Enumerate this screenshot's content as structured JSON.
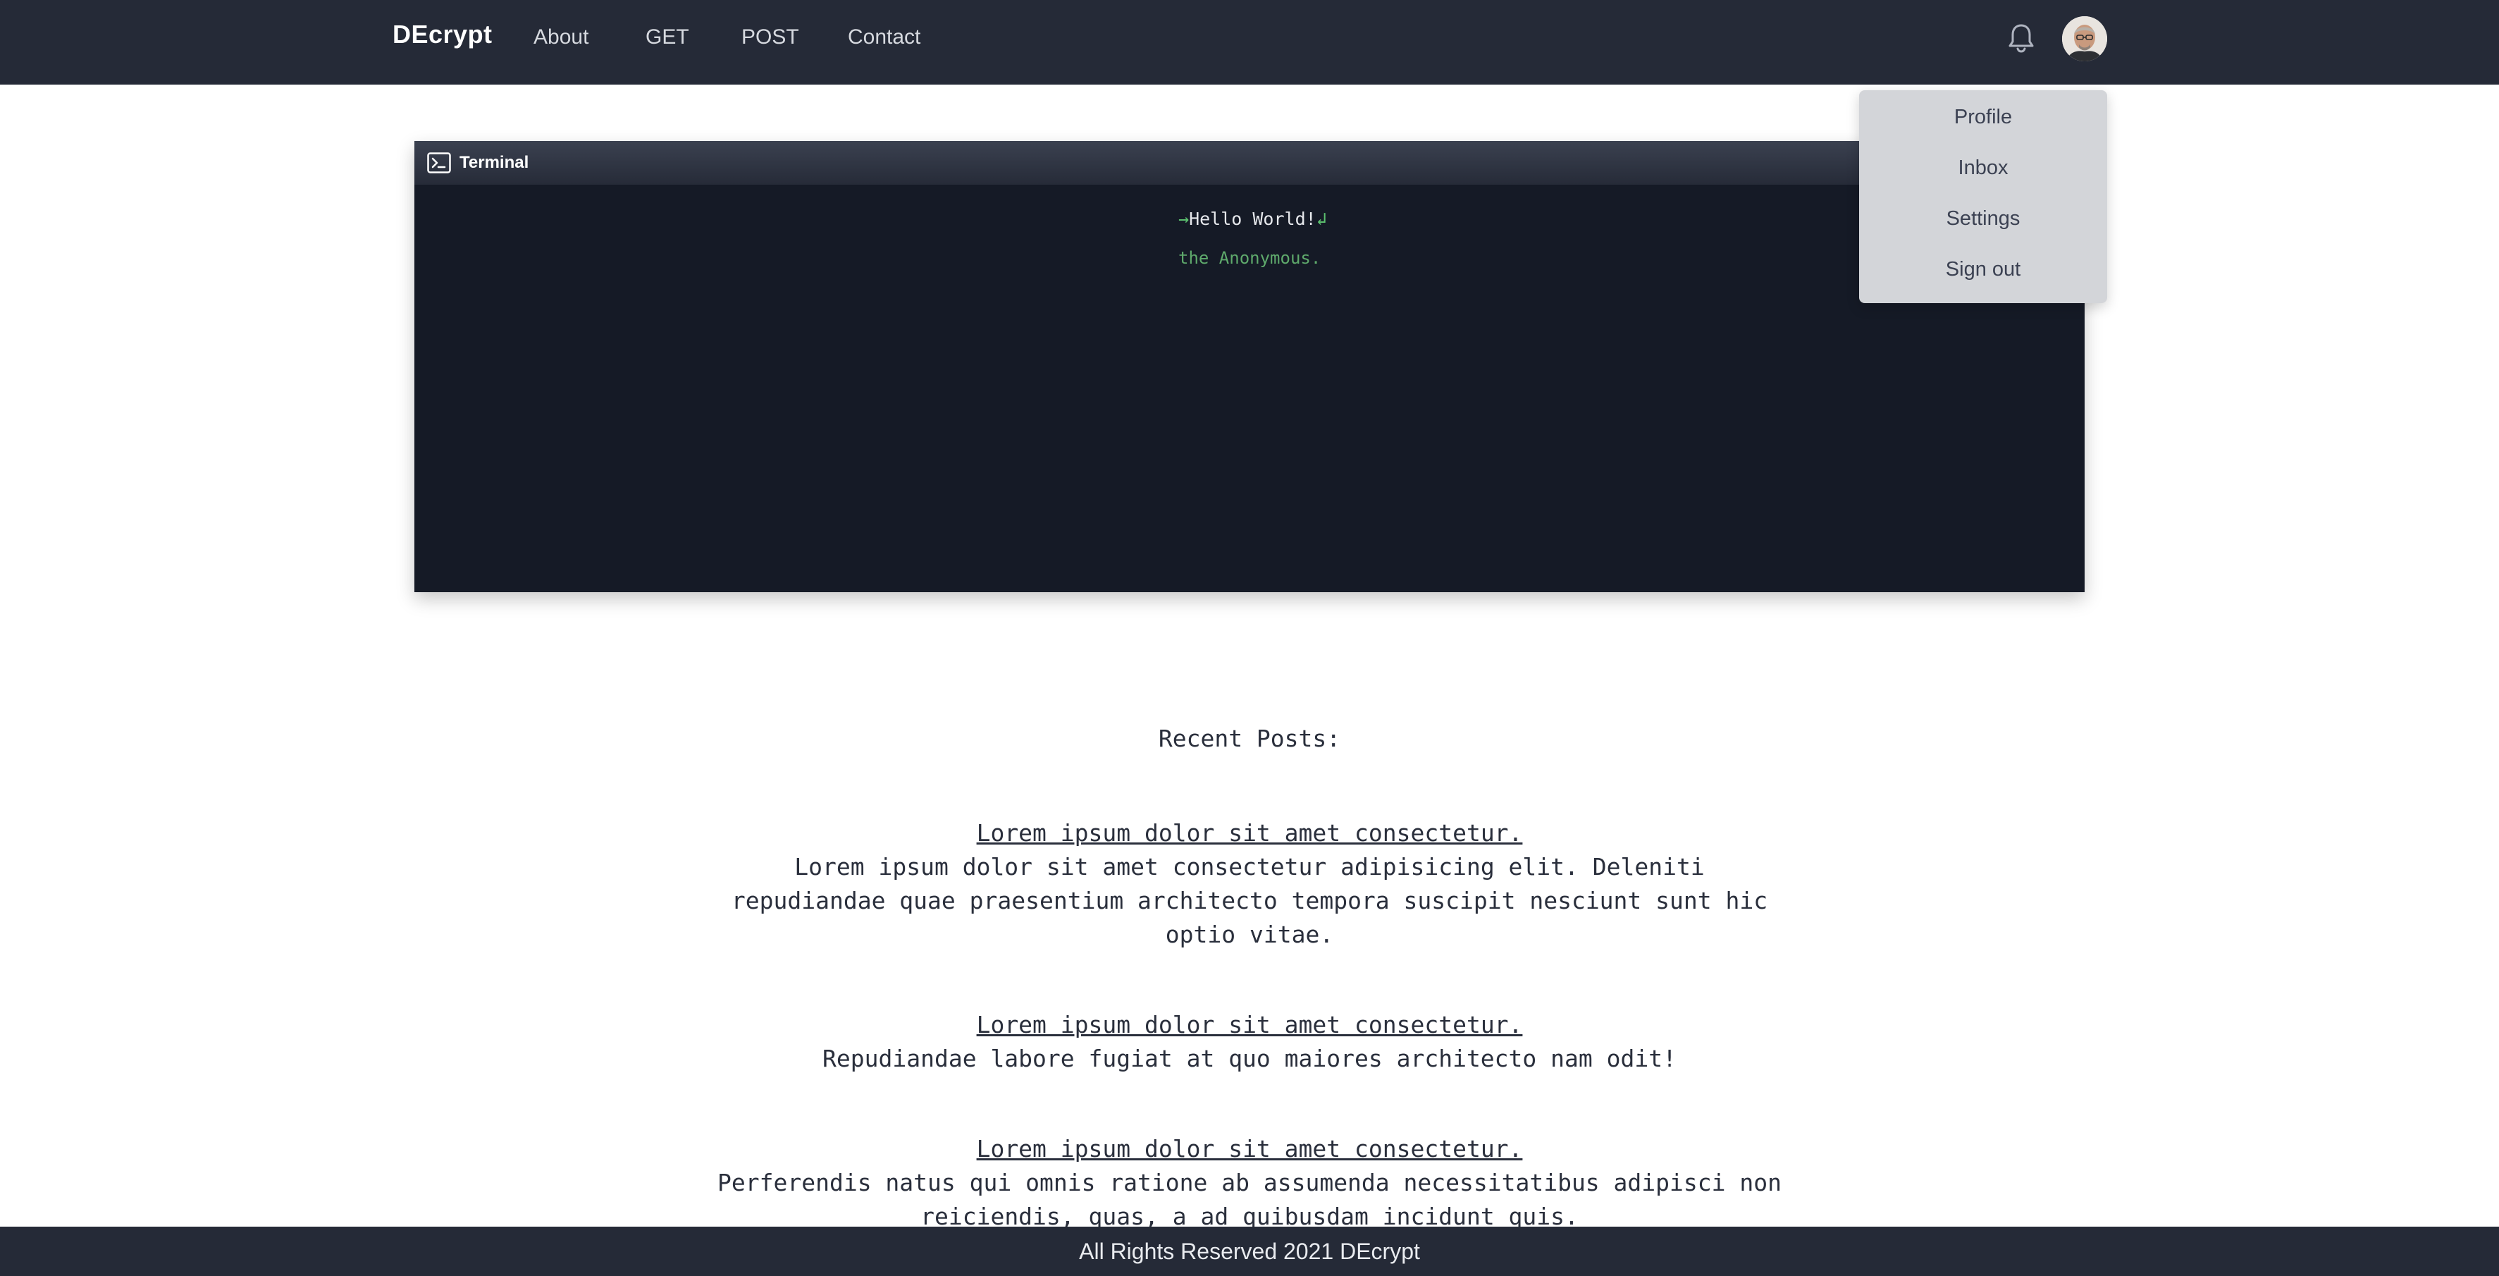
{
  "navbar": {
    "brand": "DEcrypt",
    "links": [
      "About",
      "GET",
      "POST",
      "Contact"
    ]
  },
  "user_menu": {
    "items": [
      "Profile",
      "Inbox",
      "Settings",
      "Sign out"
    ]
  },
  "terminal": {
    "title": "Terminal",
    "line1_prefix": "→",
    "line1_text": "Hello World!",
    "line1_suffix": "↲",
    "line2_text": "the Anonymous."
  },
  "posts": {
    "heading": "Recent Posts:",
    "items": [
      {
        "title": "Lorem ipsum dolor sit amet consectetur.",
        "body_lines": [
          "Lorem ipsum dolor sit amet consectetur adipisicing elit. Deleniti",
          "repudiandae quae praesentium architecto tempora suscipit nesciunt sunt hic",
          "optio vitae."
        ]
      },
      {
        "title": "Lorem ipsum dolor sit amet consectetur.",
        "body_lines": [
          "Repudiandae labore fugiat at quo maiores architecto nam odit!"
        ]
      },
      {
        "title": "Lorem ipsum dolor sit amet consectetur.",
        "body_lines": [
          "Perferendis natus qui omnis ratione ab assumenda necessitatibus adipisci non",
          "reiciendis, quas, a ad quibusdam incidunt quis."
        ]
      }
    ]
  },
  "footer": {
    "text": "All Rights Reserved 2021 DEcrypt"
  },
  "colors": {
    "navbar_bg": "#252a37",
    "terminal_bg": "#151a26",
    "terminal_green": "#5faa6c",
    "dropdown_bg": "#d3d5d9"
  },
  "icons": {
    "notifications": "bell-icon",
    "terminal": "terminal-prompt-icon",
    "user": "user-avatar"
  }
}
